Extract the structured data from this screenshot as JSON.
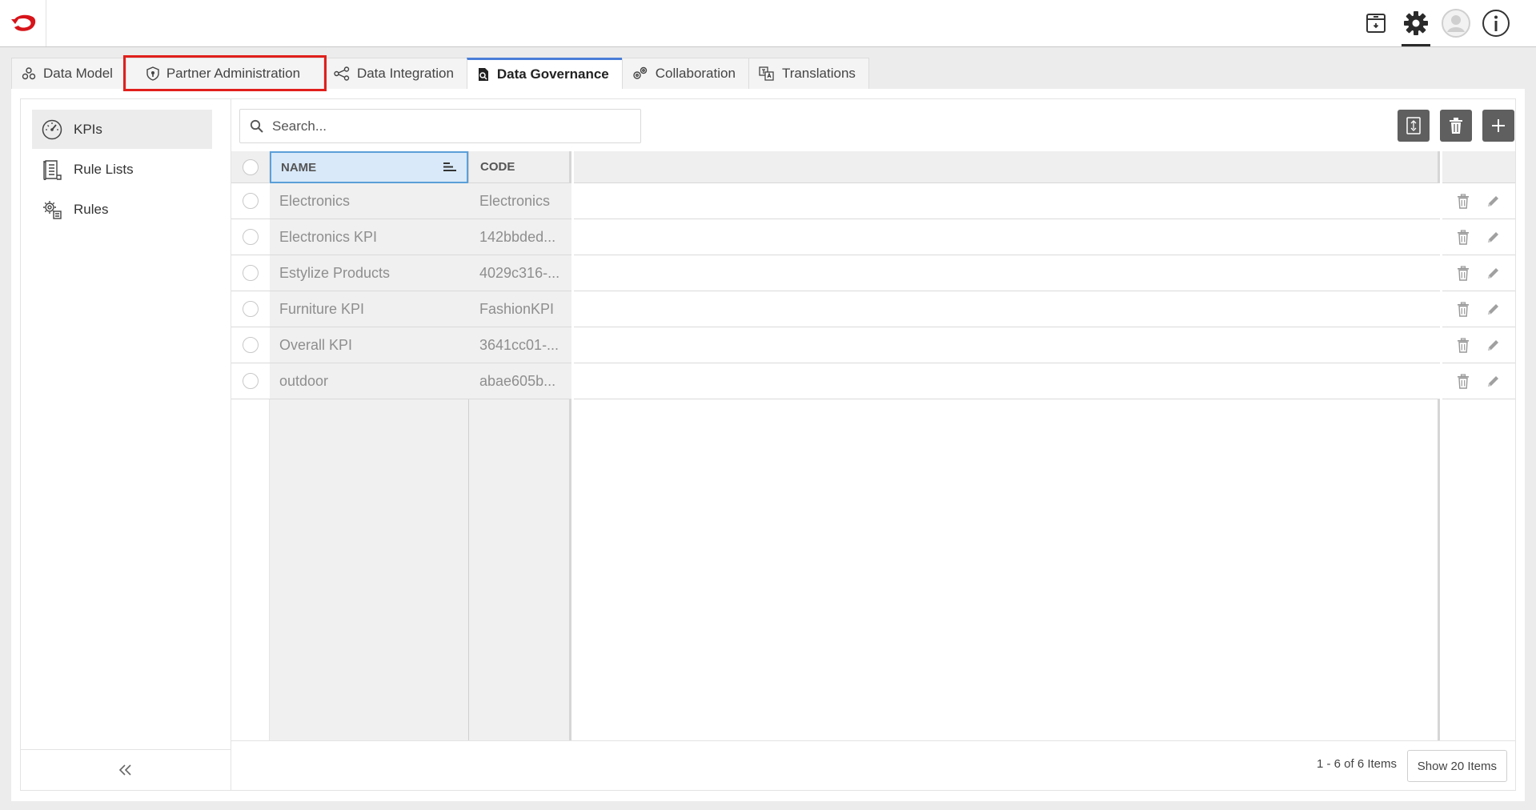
{
  "tabs": [
    {
      "label": "Data Model",
      "icon": "data-model-icon"
    },
    {
      "label": "Partner Administration",
      "icon": "shield-icon"
    },
    {
      "label": "Data Integration",
      "icon": "integration-icon"
    },
    {
      "label": "Data Governance",
      "icon": "governance-icon"
    },
    {
      "label": "Collaboration",
      "icon": "collaboration-icon"
    },
    {
      "label": "Translations",
      "icon": "translations-icon"
    }
  ],
  "active_tab": "Data Governance",
  "highlighted_tab": "Partner Administration",
  "sidebar": {
    "items": [
      {
        "label": "KPIs",
        "icon": "gauge-icon"
      },
      {
        "label": "Rule Lists",
        "icon": "rule-list-icon"
      },
      {
        "label": "Rules",
        "icon": "rules-gear-icon"
      }
    ],
    "active_item": "KPIs"
  },
  "search": {
    "placeholder": "Search..."
  },
  "grid": {
    "columns": [
      "NAME",
      "CODE"
    ],
    "sorted_column": "NAME",
    "rows": [
      {
        "name": "Electronics",
        "code": "Electronics"
      },
      {
        "name": "Electronics KPI",
        "code": "142bbded..."
      },
      {
        "name": "Estylize Products",
        "code": "4029c316-..."
      },
      {
        "name": "Furniture KPI",
        "code": "FashionKPI"
      },
      {
        "name": "Overall KPI",
        "code": "3641cc01-..."
      },
      {
        "name": "outdoor",
        "code": "abae605b..."
      }
    ]
  },
  "pager": {
    "info": "1 - 6 of 6 Items",
    "page_size_button": "Show 20 Items"
  },
  "colors": {
    "accent": "#4a7ed8",
    "highlight": "#e0201c",
    "brand": "#d7141a",
    "toolbar_button": "#5f5f5f"
  }
}
